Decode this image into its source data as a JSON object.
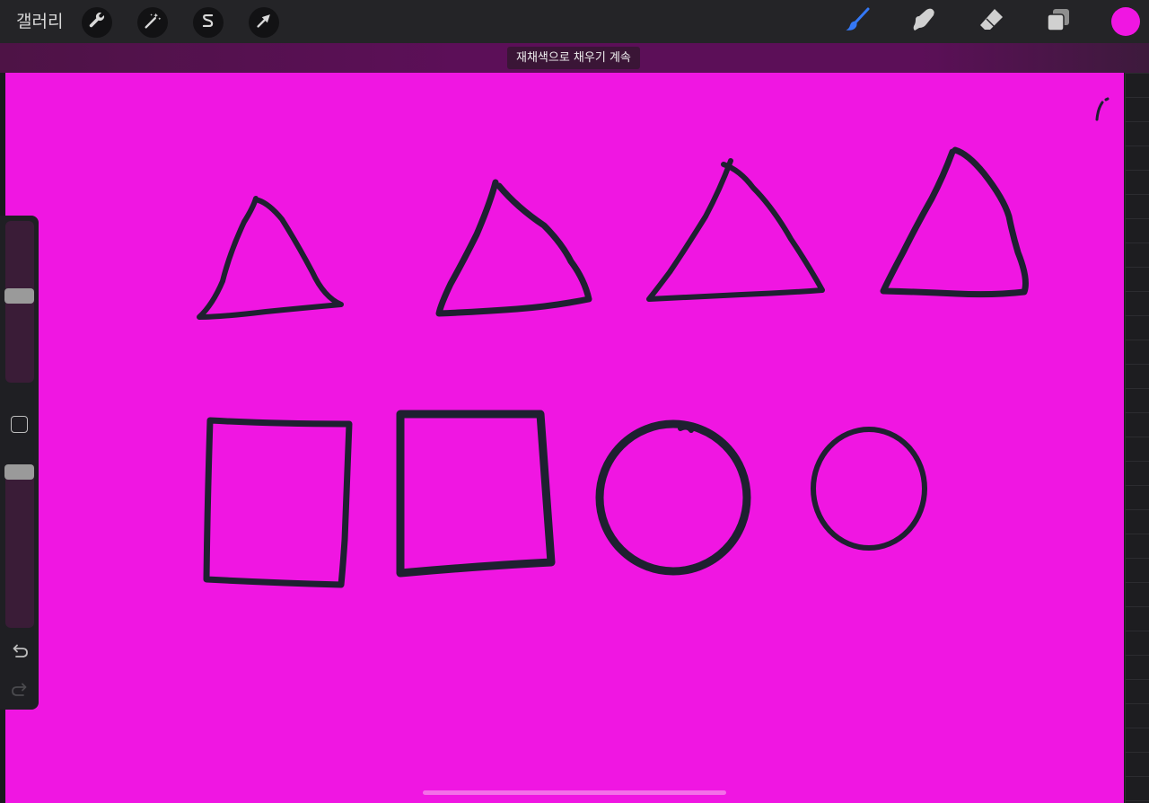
{
  "app": {
    "name": "Procreate",
    "accent_color": "#f016e2",
    "canvas_color": "#f016e2",
    "stroke_color": "#1e2030"
  },
  "toolbar": {
    "gallery_label": "갤러리",
    "left_tools": [
      {
        "id": "actions",
        "icon": "wrench-icon"
      },
      {
        "id": "adjustments",
        "icon": "magic-wand-icon"
      },
      {
        "id": "selection",
        "icon": "selection-s-icon"
      },
      {
        "id": "transform",
        "icon": "arrow-cursor-icon"
      }
    ],
    "right_tools": [
      {
        "id": "brush",
        "icon": "brush-icon",
        "active": true,
        "color": "#3478f6"
      },
      {
        "id": "smudge",
        "icon": "smudge-finger-icon"
      },
      {
        "id": "eraser",
        "icon": "eraser-icon"
      },
      {
        "id": "layers",
        "icon": "layers-icon"
      }
    ],
    "current_color": "#f016e2"
  },
  "banner": {
    "message": "재채색으로 채우기 계속"
  },
  "sidebar": {
    "brush_size": 0.45,
    "brush_opacity": 0.05,
    "undo_icon": "undo-icon",
    "redo_icon": "redo-icon",
    "modify_icon": "square-outline-icon"
  }
}
